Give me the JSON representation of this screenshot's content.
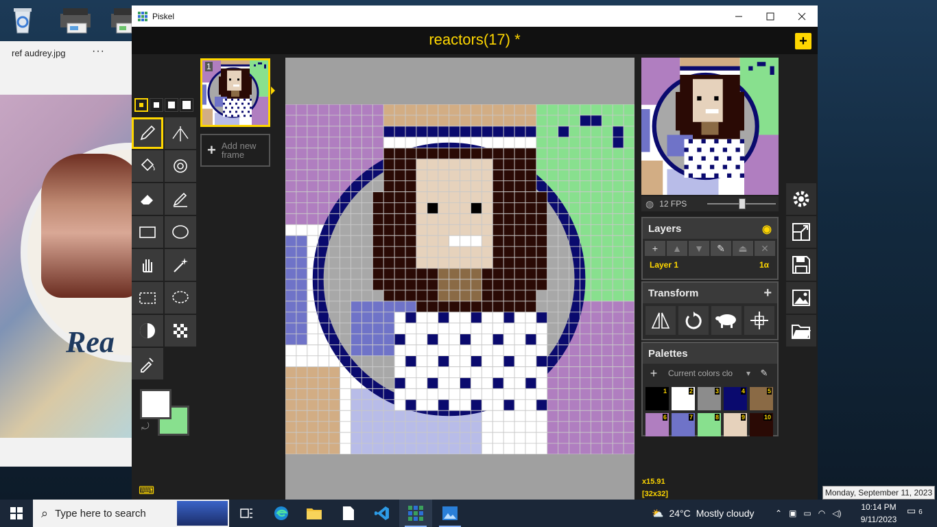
{
  "desktop": {
    "icons": [
      "recycle-bin-icon",
      "scanner-icon",
      "scanner-icon"
    ]
  },
  "photo_viewer": {
    "filename": "ref audrey.jpg",
    "more_label": "···",
    "photo_word": "Rea"
  },
  "piskel": {
    "window_title": "Piskel",
    "doc_title": "reactors(17) *",
    "new_label": "+",
    "frame_number": "1",
    "add_frame_label": "Add new frame",
    "fps_label": "12 FPS",
    "zoom": "x15.91",
    "size": "[32x32]",
    "layers": {
      "title": "Layers",
      "layer_name": "Layer 1",
      "layer_opacity": "1α"
    },
    "transform": {
      "title": "Transform"
    },
    "palettes": {
      "title": "Palettes",
      "selected": "Current colors clo",
      "swatches": [
        {
          "num": "1",
          "color": "#000000"
        },
        {
          "num": "2",
          "color": "#ffffff"
        },
        {
          "num": "3",
          "color": "#8c8c8c"
        },
        {
          "num": "4",
          "color": "#0a0a6e"
        },
        {
          "num": "5",
          "color": "#8a6a45"
        },
        {
          "num": "6",
          "color": "#b07ec0"
        },
        {
          "num": "7",
          "color": "#6f73c8"
        },
        {
          "num": "8",
          "color": "#88e08e"
        },
        {
          "num": "9",
          "color": "#e6d2bc"
        },
        {
          "num": "10",
          "color": "#2a0a05"
        }
      ]
    }
  },
  "taskbar": {
    "search_placeholder": "Type here to search",
    "weather_temp": "24°C",
    "weather_text": "Mostly cloudy",
    "time": "10:14 PM",
    "date": "9/11/2023",
    "notifications": "6",
    "date_tooltip": "Monday, September 11, 2023"
  },
  "colors": {
    "accent": "#ffd700",
    "primary_color": "#ffffff",
    "secondary_color": "#88e08e"
  }
}
